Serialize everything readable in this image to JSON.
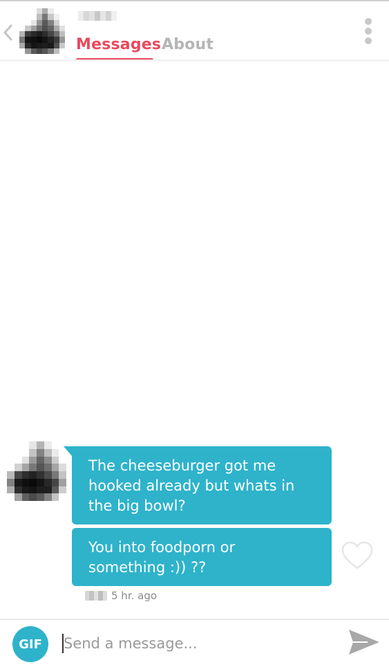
{
  "header": {
    "tabs": [
      {
        "label": "Messages",
        "active": true
      },
      {
        "label": "About",
        "active": false
      }
    ]
  },
  "conversation": {
    "messages": [
      {
        "text": "The cheeseburger got me hooked already but whats in the big bowl?"
      },
      {
        "text": "You into foodporn or something :)) ??"
      }
    ],
    "timestamp": "5 hr. ago"
  },
  "composer": {
    "gif_label": "GIF",
    "placeholder": "Send a message..."
  },
  "colors": {
    "accent": "#e84a5f",
    "inactive_tab": "#b5b5b5",
    "bubble": "#2eb3cb",
    "gif_button": "#2eb3cb",
    "heart_outline": "#e6e6e6",
    "send_icon": "#a8a8a8"
  },
  "icons": {
    "back": "chevron-left-icon",
    "menu": "more-vertical-icon",
    "like": "heart-outline-icon",
    "send": "send-icon"
  }
}
